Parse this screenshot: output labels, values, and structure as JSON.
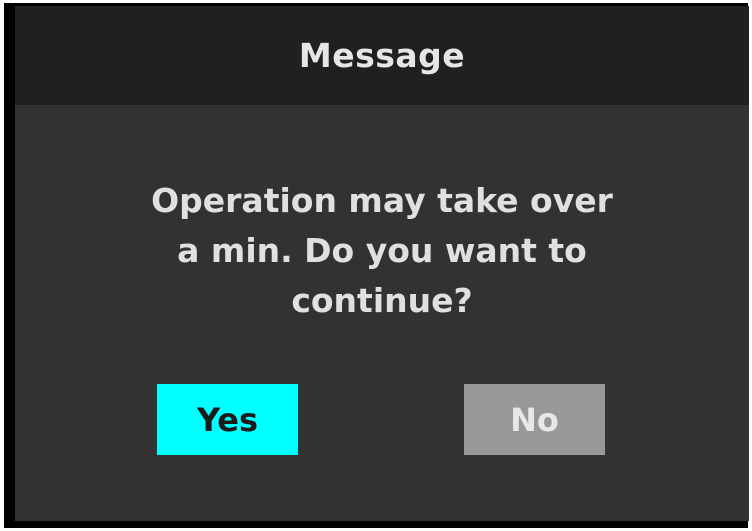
{
  "dialog": {
    "title": "Message",
    "message_lines": [
      "Operation may take over",
      "a min. Do you want to",
      "continue?"
    ],
    "yes_label": "Yes",
    "no_label": "No"
  },
  "colors": {
    "frame": "#000000",
    "titlebar": "#202020",
    "body": "#323232",
    "yes_button": "#00ffff",
    "no_button": "#989898"
  }
}
